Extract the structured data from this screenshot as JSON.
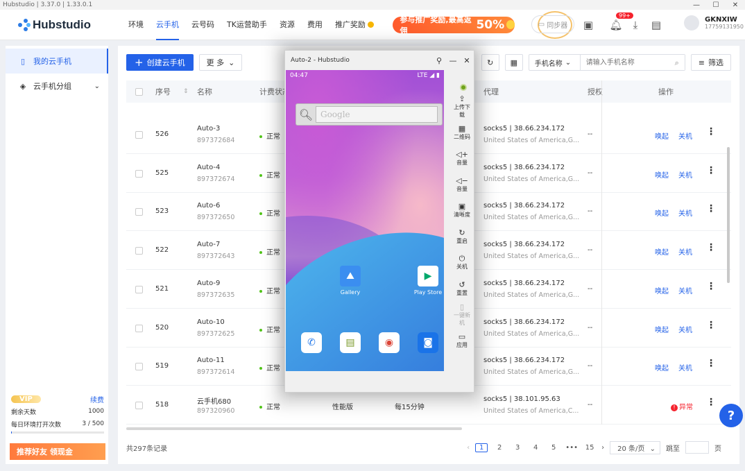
{
  "titlebar": {
    "text": "Hubstudio | 3.37.0 | 1.33.0.1",
    "min": "—",
    "max": "☐",
    "close": "✕"
  },
  "header": {
    "logo_text": "Hubstudio",
    "nav": [
      "环境",
      "云手机",
      "云号码",
      "TK运营助手",
      "资源",
      "费用",
      "推广奖励"
    ],
    "promo_text": "参与推广奖励,最高返佣",
    "promo_percent": "50%",
    "sync_label": "同步器",
    "notif_badge": "99+",
    "user_name": "GKNXIW",
    "user_phone": "17759131950"
  },
  "sidebar": {
    "items": [
      {
        "label": "我的云手机",
        "icon": "phone-icon"
      },
      {
        "label": "云手机分组",
        "icon": "layers-icon"
      }
    ],
    "vip_label": "VIP",
    "renew_label": "续费",
    "days_label": "剩余天数",
    "days_value": "1000",
    "opens_label": "每日环境打开次数",
    "opens_value": "3 / 500",
    "refer_label": "推荐好友 领现金"
  },
  "toolbar": {
    "create_label": "创建云手机",
    "more_label": "更 多",
    "search_select": "手机名称",
    "search_placeholder": "请输入手机名称",
    "filter_label": "筛选"
  },
  "table": {
    "headers": {
      "seq": "序号",
      "name": "名称",
      "billing": "计费状态",
      "proxy": "代理",
      "auth": "授权",
      "ops": "操作"
    },
    "rows": [
      {
        "seq": "526",
        "name": "Auto-3",
        "id": "897372684",
        "status": "正常",
        "proxy": "socks5 | 38.66.234.172",
        "loc": "United States of America,G...",
        "auth": "--",
        "a1": "唤起",
        "a2": "关机"
      },
      {
        "seq": "525",
        "name": "Auto-4",
        "id": "897372674",
        "status": "正常",
        "proxy": "socks5 | 38.66.234.172",
        "loc": "United States of America,G...",
        "auth": "--",
        "a1": "唤起",
        "a2": "关机"
      },
      {
        "seq": "523",
        "name": "Auto-6",
        "id": "897372650",
        "status": "正常",
        "proxy": "socks5 | 38.66.234.172",
        "loc": "United States of America,G...",
        "auth": "--",
        "a1": "唤起",
        "a2": "关机"
      },
      {
        "seq": "522",
        "name": "Auto-7",
        "id": "897372643",
        "status": "正常",
        "proxy": "socks5 | 38.66.234.172",
        "loc": "United States of America,G...",
        "auth": "--",
        "a1": "唤起",
        "a2": "关机"
      },
      {
        "seq": "521",
        "name": "Auto-9",
        "id": "897372635",
        "status": "正常",
        "proxy": "socks5 | 38.66.234.172",
        "loc": "United States of America,G...",
        "auth": "--",
        "a1": "唤起",
        "a2": "关机"
      },
      {
        "seq": "520",
        "name": "Auto-10",
        "id": "897372625",
        "status": "正常",
        "proxy": "socks5 | 38.66.234.172",
        "loc": "United States of America,G...",
        "auth": "--",
        "a1": "唤起",
        "a2": "关机"
      },
      {
        "seq": "519",
        "name": "Auto-11",
        "id": "897372614",
        "status": "正常",
        "proxy": "socks5 | 38.66.234.172",
        "loc": "United States of America,G...",
        "auth": "--",
        "a1": "唤起",
        "a2": "关机"
      },
      {
        "seq": "518",
        "name": "云手机680",
        "id": "897320960",
        "status": "正常",
        "plan": "性能版",
        "billing": "每15分钟",
        "proxy": "socks5 | 38.101.95.63",
        "loc": "United States of America,C...",
        "auth": "--",
        "a1": "异常",
        "a2": ""
      }
    ]
  },
  "footer": {
    "total": "共297条记录",
    "pages": [
      "1",
      "2",
      "3",
      "4",
      "5",
      "•••",
      "15"
    ],
    "page_size": "20 条/页",
    "jump_label": "跳至",
    "page_unit": "页"
  },
  "phone": {
    "title": "Auto-2 - Hubstudio",
    "time": "04:47",
    "signal": "LTE ◢ ▮",
    "search_placeholder": "Google",
    "apps": [
      "Gallery",
      "Play Store"
    ],
    "tools": [
      "上传下载",
      "二维码",
      "音量",
      "音量",
      "清晰度",
      "重启",
      "关机",
      "重置",
      "一键新机",
      "应用"
    ]
  }
}
